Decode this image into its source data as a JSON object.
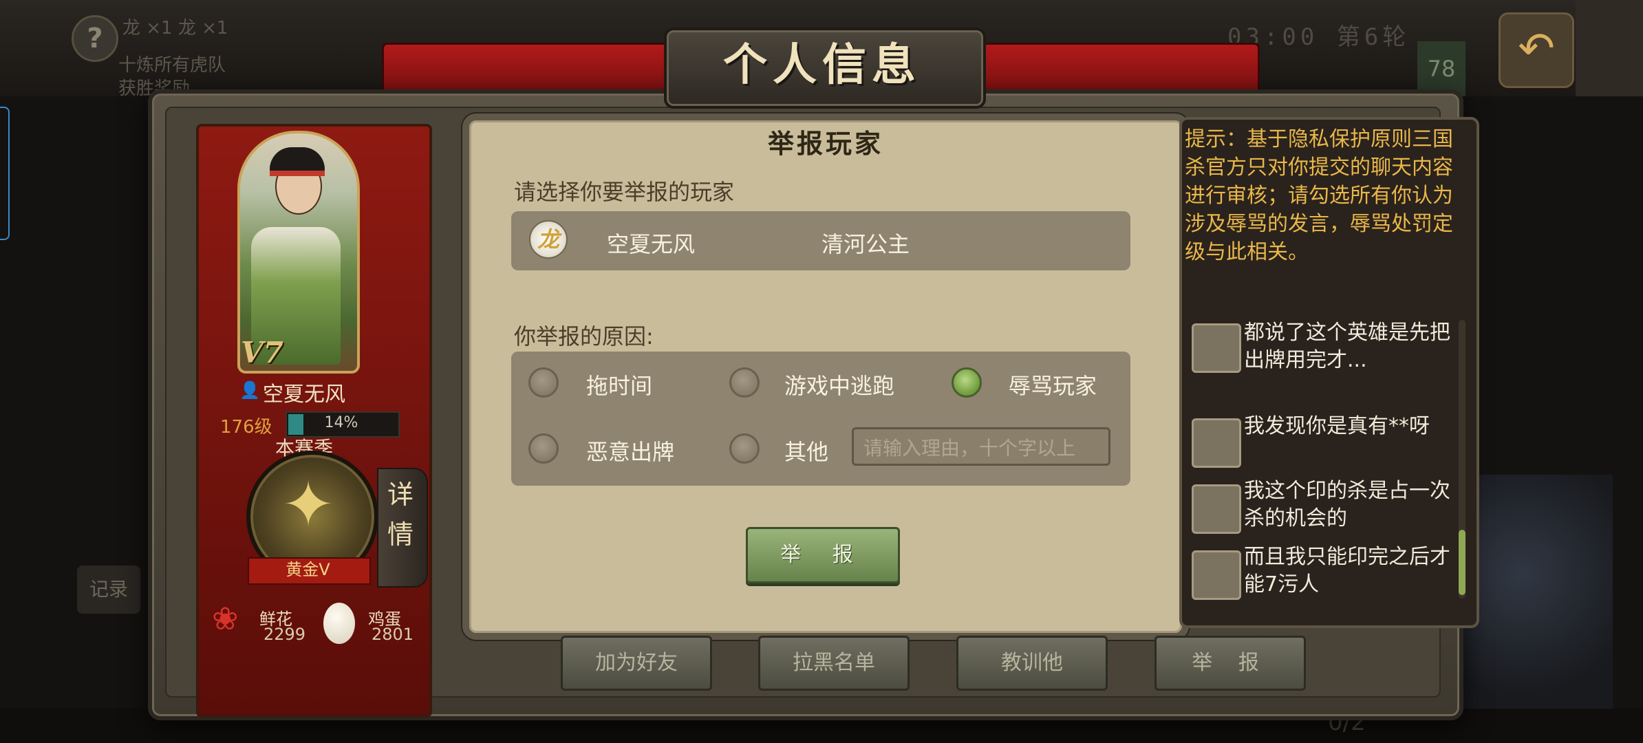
{
  "background": {
    "help_icon": "?",
    "top_left_line1": "龙 ×1  龙 ×1",
    "top_left_line2": "十炼所有虎队",
    "top_left_line3": "获胜奖励",
    "timer": "03:00 第6轮",
    "count": "78",
    "record_label": "记录",
    "bottom_fraction": "0/2"
  },
  "header": {
    "title": "个人信息"
  },
  "player": {
    "vip": "V7",
    "name": "空夏无风",
    "level": "176级",
    "xp_percent": "14%",
    "xp_fraction": 0.14,
    "season_label": "本赛季",
    "rank": "黄金V",
    "detail_tab": "详情",
    "gifts": [
      {
        "icon": "rose-icon",
        "name": "鲜花",
        "count": "2299"
      },
      {
        "icon": "egg-icon",
        "name": "鸡蛋",
        "count": "2801"
      }
    ]
  },
  "report_dialog": {
    "title": "举报玩家",
    "select_prompt": "请选择你要举报的玩家",
    "target_player": {
      "avatar_glyph": "龙",
      "name": "空夏无风",
      "character": "清河公主"
    },
    "reason_prompt": "你举报的原因:",
    "reasons": [
      {
        "label": "拖时间",
        "selected": false
      },
      {
        "label": "游戏中逃跑",
        "selected": false
      },
      {
        "label": "辱骂玩家",
        "selected": true
      },
      {
        "label": "恶意出牌",
        "selected": false
      },
      {
        "label": "其他",
        "selected": false
      }
    ],
    "reason_input_placeholder": "请输入理由，十个字以上",
    "submit_label": "举 报"
  },
  "tip_panel": {
    "tip": "提示：基于隐私保护原则三国杀官方只对你提交的聊天内容进行审核；请勾选所有你认为涉及辱骂的发言，辱骂处罚定级与此相关。",
    "messages": [
      "都说了这个英雄是先把出牌用完才...",
      "我发现你是真有**呀",
      "我这个印的杀是占一次杀的机会的",
      "而且我只能印完之后才能7污人"
    ]
  },
  "actions": {
    "add_friend": "加为好友",
    "blacklist": "拉黑名单",
    "teach": "教训他",
    "report": "举 报"
  },
  "colors": {
    "accent_gold": "#e9b84a",
    "report_green": "#7d9d5e",
    "banner_red": "#b01a1a"
  }
}
